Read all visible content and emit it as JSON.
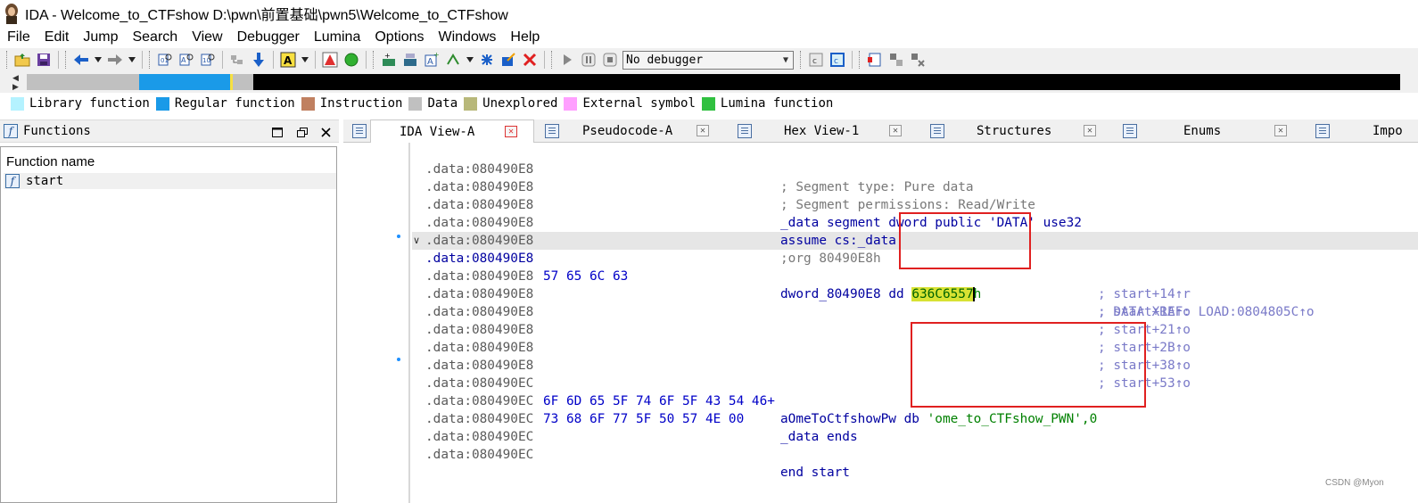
{
  "window": {
    "title": "IDA - Welcome_to_CTFshow D:\\pwn\\前置基础\\pwn5\\Welcome_to_CTFshow"
  },
  "menu": [
    "File",
    "Edit",
    "Jump",
    "Search",
    "View",
    "Debugger",
    "Lumina",
    "Options",
    "Windows",
    "Help"
  ],
  "toolbar": {
    "debugger_select": "No debugger"
  },
  "legend": [
    {
      "label": "Library function",
      "color": "#b4f2ff"
    },
    {
      "label": "Regular function",
      "color": "#1a9ae8"
    },
    {
      "label": "Instruction",
      "color": "#c08060"
    },
    {
      "label": "Data",
      "color": "#c0c0c0"
    },
    {
      "label": "Unexplored",
      "color": "#b8b87a"
    },
    {
      "label": "External symbol",
      "color": "#ffa0ff"
    },
    {
      "label": "Lumina function",
      "color": "#30c040"
    }
  ],
  "functions_panel": {
    "title": "Functions",
    "column_header": "Function name",
    "rows": [
      {
        "name": "start"
      }
    ]
  },
  "tabs": [
    {
      "label": "IDA View-A",
      "active": true
    },
    {
      "label": "Pseudocode-A",
      "active": false
    },
    {
      "label": "Hex View-1",
      "active": false
    },
    {
      "label": "Structures",
      "active": false
    },
    {
      "label": "Enums",
      "active": false
    },
    {
      "label": "Impo",
      "active": false
    }
  ],
  "disasm": {
    "lines": [
      {
        "addr": ".data:080490E8",
        "bytes": "",
        "instr": "; Segment type: Pure data",
        "comment": ""
      },
      {
        "addr": ".data:080490E8",
        "bytes": "",
        "instr": "; Segment permissions: Read/Write",
        "comment": ""
      },
      {
        "addr": ".data:080490E8",
        "bytes": "",
        "instr": "_data segment dword public 'DATA' use32",
        "comment": ""
      },
      {
        "addr": ".data:080490E8",
        "bytes": "",
        "instr": "assume cs:_data",
        "comment": ""
      },
      {
        "addr": ".data:080490E8",
        "bytes": "",
        "instr": ";org 80490E8h",
        "comment": ""
      },
      {
        "addr": ".data:080490E8",
        "bytes": "57 65 6C 63",
        "instr": "dword_80490E8 dd 636C6557h",
        "comment": "; DATA XREF: LOAD:0804805C↑o"
      },
      {
        "addr": ".data:080490E8",
        "bytes": "",
        "instr": "",
        "comment": "; start+14↑r"
      },
      {
        "addr": ".data:080490E8",
        "bytes": "",
        "instr": "",
        "comment": "; start+1A↑o"
      },
      {
        "addr": ".data:080490E8",
        "bytes": "",
        "instr": "",
        "comment": "; start+21↑o"
      },
      {
        "addr": ".data:080490E8",
        "bytes": "",
        "instr": "",
        "comment": "; start+2B↑o"
      },
      {
        "addr": ".data:080490E8",
        "bytes": "",
        "instr": "",
        "comment": "; start+38↑o"
      },
      {
        "addr": ".data:080490E8",
        "bytes": "",
        "instr": "",
        "comment": "; start+53↑o"
      },
      {
        "addr": ".data:080490EC",
        "bytes": "6F 6D 65 5F 74 6F 5F 43 54 46+",
        "instr": "aOmeToCtfshowPw db 'ome_to_CTFshow_PWN',0",
        "comment": ""
      },
      {
        "addr": ".data:080490EC",
        "bytes": "73 68 6F 77 5F 50 57 4E 00",
        "instr": "_data ends",
        "comment": ""
      },
      {
        "addr": ".data:080490EC",
        "bytes": "",
        "instr": "",
        "comment": ""
      },
      {
        "addr": ".data:080490EC",
        "bytes": "",
        "instr": "",
        "comment": ""
      },
      {
        "addr": ".data:080490EC",
        "bytes": "",
        "instr": "end start",
        "comment": ""
      }
    ],
    "segments": {
      "seg_type": "; Segment type: Pure data",
      "seg_perm": "; Segment permissions: Read/Write",
      "data_kw": "_data segment dword public 'DATA' use32",
      "assume": "assume cs:_data",
      "org": ";org 80490E8h",
      "dword_name": "dword_80490E8",
      "dd_kw": "dd",
      "dword_value": "636C6557",
      "dword_suffix": "h",
      "str_name": "aOmeToCtfshowPw",
      "db_kw": "db",
      "str_literal": "'ome_to_CTFshow_PWN'",
      "str_term": ",0",
      "data_ends": "_data ends",
      "end_start": "end start"
    }
  },
  "watermark": "CSDN @Myon⁠"
}
